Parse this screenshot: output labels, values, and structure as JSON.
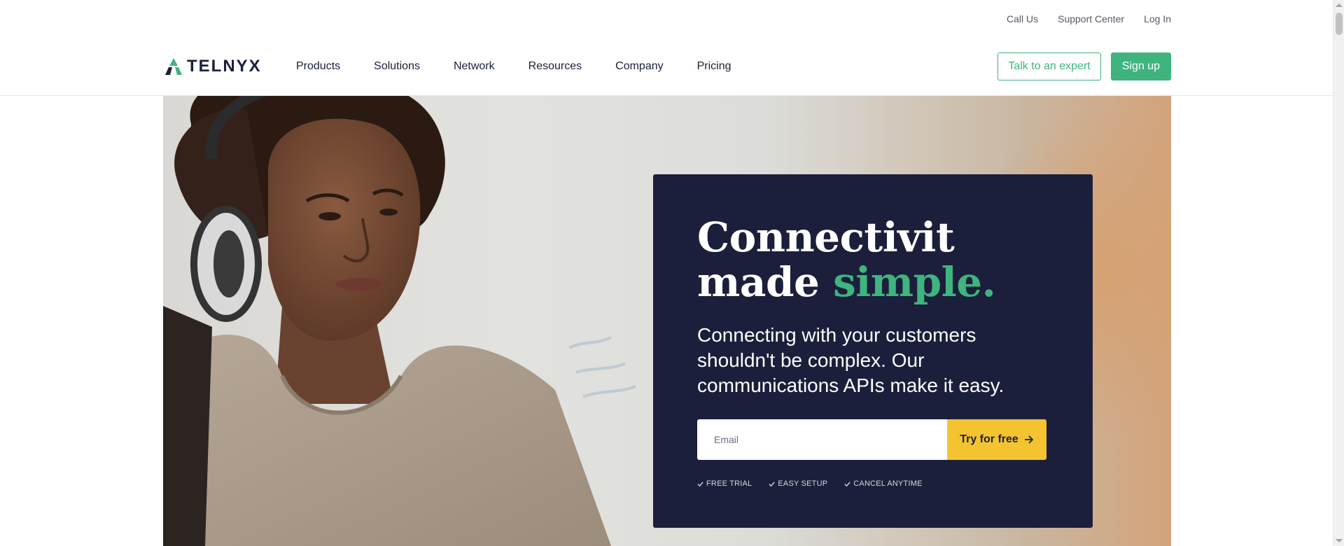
{
  "utility_nav": {
    "items": [
      "Call Us",
      "Support Center",
      "Log In"
    ]
  },
  "brand": {
    "logo_text": "TELNYX",
    "logo_icon": "telnyx-triangle-logo",
    "accent_color": "#3fb47f",
    "navy_color": "#1b1f3b",
    "cta_color": "#f4c430"
  },
  "main_nav": {
    "items": [
      "Products",
      "Solutions",
      "Network",
      "Resources",
      "Company",
      "Pricing"
    ],
    "talk_label": "Talk to an expert",
    "signup_label": "Sign up"
  },
  "hero": {
    "headline_line1": "Connectivit",
    "headline_line2_plain": "made",
    "headline_line2_accent": "simple.",
    "subtext": "Connecting with your customers shouldn't be complex. Our communications APIs make it easy.",
    "email_placeholder": "Email",
    "cta_label": "Try for free",
    "cta_icon": "arrow-right-icon",
    "perks": [
      "FREE TRIAL",
      "EASY SETUP",
      "CANCEL ANYTIME"
    ],
    "perk_icon": "checkmark-icon"
  }
}
